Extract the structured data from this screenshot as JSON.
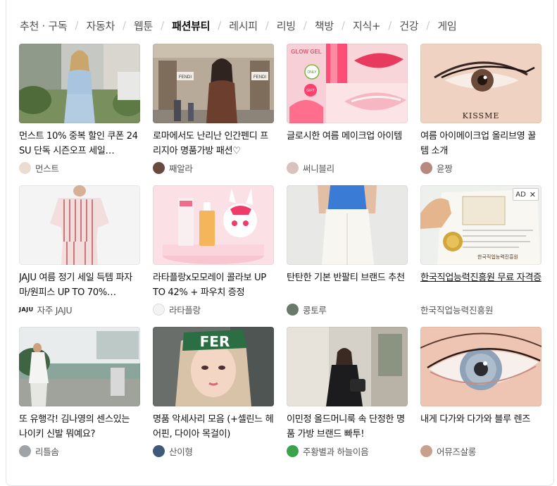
{
  "tabs": [
    {
      "label": "추천 · 구독",
      "active": false
    },
    {
      "label": "자동차",
      "active": false
    },
    {
      "label": "웹툰",
      "active": false
    },
    {
      "label": "패션뷰티",
      "active": true
    },
    {
      "label": "레시피",
      "active": false
    },
    {
      "label": "리빙",
      "active": false
    },
    {
      "label": "책방",
      "active": false
    },
    {
      "label": "지식+",
      "active": false
    },
    {
      "label": "건강",
      "active": false
    },
    {
      "label": "게임",
      "active": false
    }
  ],
  "cards": [
    {
      "title": "먼스트 10% 중복 할인 쿠폰 24 SU 단독 시즌오프 세일…",
      "author": "먼스트"
    },
    {
      "title": "로마에서도 난리난 인간펜디 프리지아 명품가방 패션♡",
      "author": "째알라"
    },
    {
      "title": "글로시한 여름 메이크업 아이템",
      "author": "써니블리"
    },
    {
      "title": "여름 아이메이크업 올리브영 꿀템 소개",
      "author": "윤짱"
    },
    {
      "title": "JAJU 여름 정기 세일 득템 파자마/원피스 UP TO 70%…",
      "author": "자주 JAJU",
      "logo": "JAJU"
    },
    {
      "title": "라타플랑x모모레이 콜라보 UP TO 42% + 파우치 증정",
      "author": "라타플랑"
    },
    {
      "title": "탄탄한 기본 반팔티 브랜드 추천",
      "author": "콩토루"
    },
    {
      "title": "한국직업능력진흥원 무료 자격증",
      "author": "한국직업능력진흥원",
      "ad": true,
      "ad_label": "AD",
      "ad_close": "✕"
    },
    {
      "title": "또 유행각! 김나영의 센스있는 나이키 신발 뭐예요?",
      "author": "리틀솜"
    },
    {
      "title": "명품 악세사리 모음 (+셀린느 헤어핀, 다이아 목걸이)",
      "author": "산이형"
    },
    {
      "title": "이민정 올드머니룩 속 단정한 명품 가방 브랜드 빠투!",
      "author": "주황별과 하늘이음"
    },
    {
      "title": "내게 다가와 다가와 블루 렌즈",
      "author": "어뮤즈살롱"
    }
  ],
  "thumb_text": {
    "fendi1": "FENDI",
    "fendi2": "FENDI",
    "glow": "GLOW GEL",
    "only": "ONLY",
    "gift": "GIFT",
    "kissme": "KISSME",
    "cert": "한국직업능력진흥원",
    "headband": "FER"
  },
  "colors": {
    "active_tab": "#111111",
    "tab": "#505050",
    "separator": "#c9cbce",
    "author": "#555555"
  },
  "icons": {
    "tab_separator": "/",
    "ad_close": "close-icon"
  }
}
